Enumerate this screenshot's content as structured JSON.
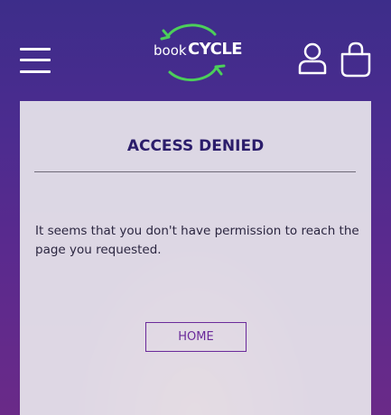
{
  "header": {
    "menu_icon": "hamburger-menu-icon",
    "logo": {
      "prefix": "book",
      "name": "CYCLE",
      "icon": "recycle-arrows-icon"
    },
    "account_icon": "user-icon",
    "cart_icon": "shopping-bag-icon"
  },
  "main": {
    "title": "ACCESS DENIED",
    "message": "It seems that you don't have permission to reach the page you requested.",
    "home_button_label": "HOME"
  },
  "colors": {
    "background_top": "#3d2d8a",
    "background_bottom": "#6a2a88",
    "logo_arrow": "#4ccf5a",
    "title": "#2b1d6b",
    "button_accent": "#6a2a9a"
  }
}
